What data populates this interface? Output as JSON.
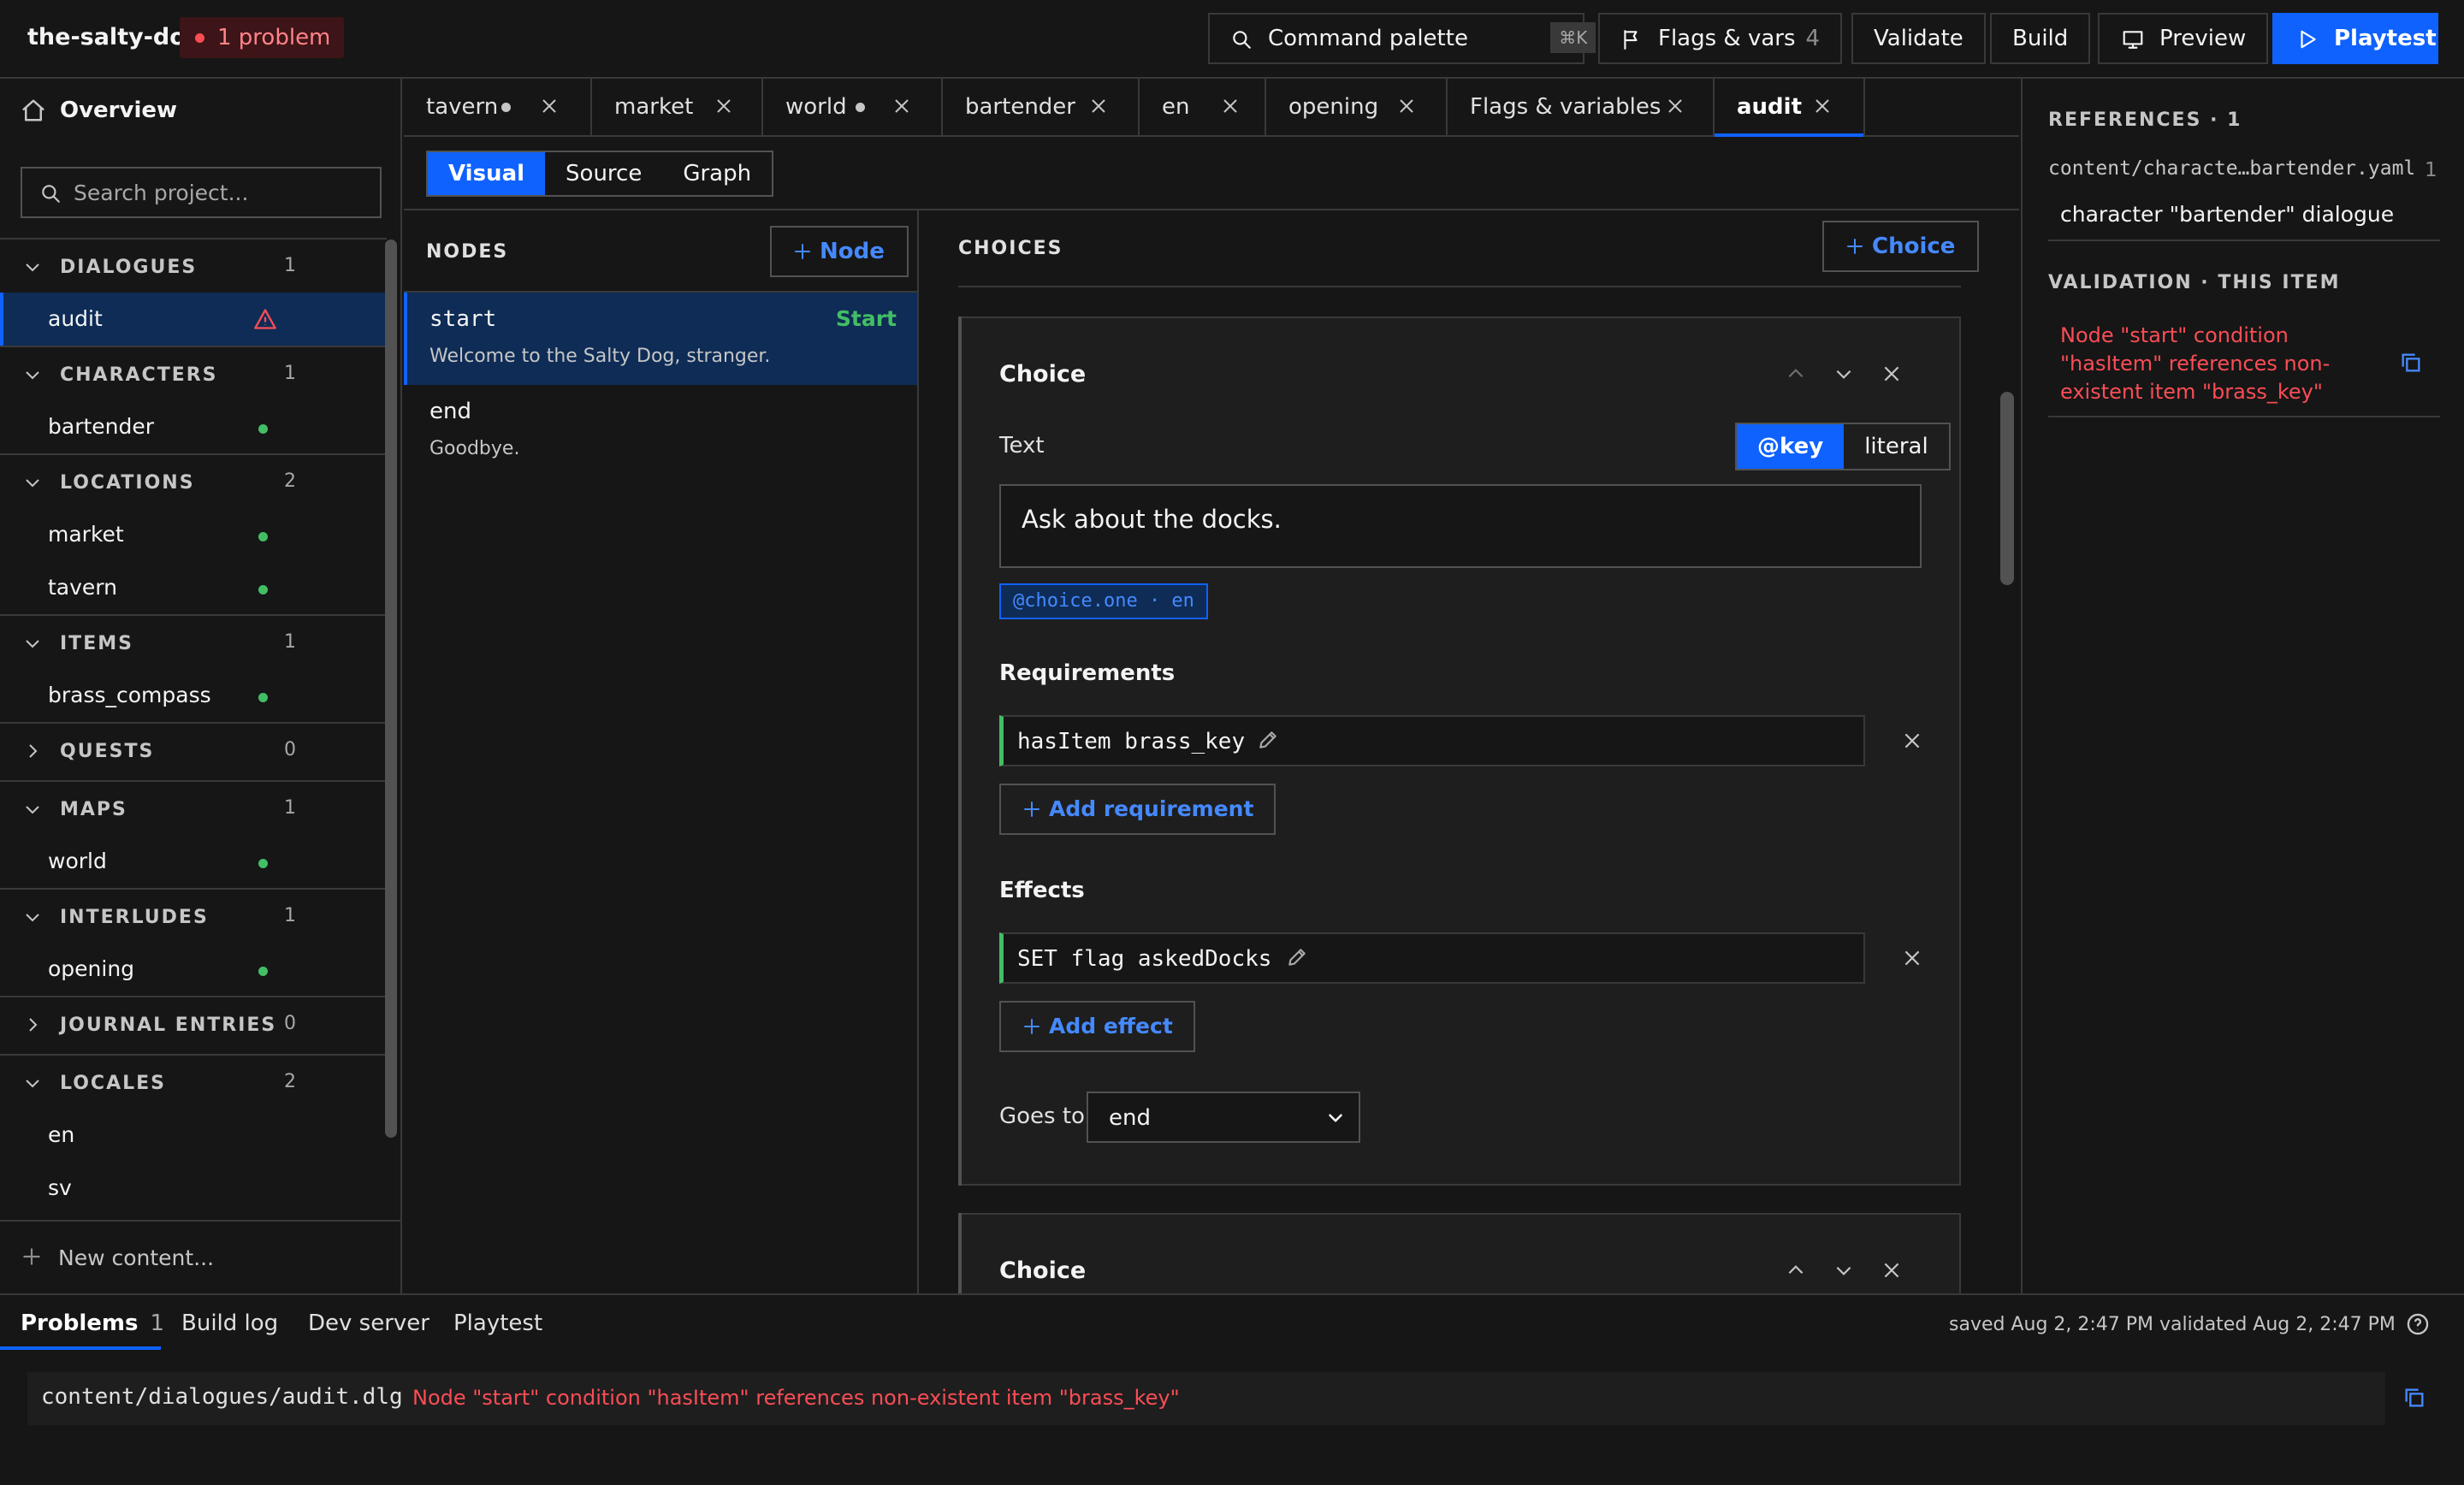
{
  "app": {
    "title": "the-salty-dog",
    "problems_badge": "1 problem"
  },
  "topbar": {
    "command_palette": "Command palette",
    "shortcut": "⌘K",
    "flags_vars": "Flags & vars",
    "flags_count": "4",
    "validate": "Validate",
    "build": "Build",
    "preview": "Preview",
    "playtest": "Playtest"
  },
  "sidebar": {
    "overview": "Overview",
    "search_placeholder": "Search project...",
    "sections": [
      {
        "name": "DIALOGUES",
        "count": "1",
        "items": [
          "audit"
        ]
      },
      {
        "name": "CHARACTERS",
        "count": "1",
        "items": [
          "bartender"
        ]
      },
      {
        "name": "LOCATIONS",
        "count": "2",
        "items": [
          "market",
          "tavern"
        ]
      },
      {
        "name": "ITEMS",
        "count": "1",
        "items": [
          "brass_compass"
        ]
      },
      {
        "name": "QUESTS",
        "count": "0",
        "items": []
      },
      {
        "name": "MAPS",
        "count": "1",
        "items": [
          "world"
        ]
      },
      {
        "name": "INTERLUDES",
        "count": "1",
        "items": [
          "opening"
        ]
      },
      {
        "name": "JOURNAL ENTRIES",
        "count": "0",
        "items": []
      },
      {
        "name": "LOCALES",
        "count": "2",
        "items": [
          "en",
          "sv"
        ]
      }
    ],
    "new_content": "New content..."
  },
  "tabs": [
    "tavern",
    "market",
    "world",
    "bartender",
    "en",
    "opening",
    "Flags & variables",
    "audit"
  ],
  "view_modes": [
    "Visual",
    "Source",
    "Graph"
  ],
  "nodes_panel": {
    "header": "NODES",
    "add_node": "Node",
    "nodes": [
      {
        "name": "start",
        "text": "Welcome to the Salty Dog, stranger.",
        "tag": "Start"
      },
      {
        "name": "end",
        "text": "Goodbye."
      }
    ]
  },
  "choices_panel": {
    "header": "CHOICES",
    "add_choice": "Choice",
    "choice": {
      "title": "Choice",
      "text_label": "Text",
      "mode_key": "@key",
      "mode_literal": "literal",
      "text_value": "Ask about the docks.",
      "key_tag": "@choice.one · en",
      "requirements_label": "Requirements",
      "requirement": "hasItem brass_key",
      "add_requirement": "Add requirement",
      "effects_label": "Effects",
      "effect": "SET flag askedDocks",
      "add_effect": "Add effect",
      "goes_to_label": "Goes to",
      "goes_to_value": "end"
    },
    "choice2_title": "Choice"
  },
  "right_panel": {
    "references_header": "REFERENCES · 1",
    "ref_path": "content/characte…bartender.yaml",
    "ref_line": "1",
    "ref_desc": "character \"bartender\" dialogue",
    "validation_header": "VALIDATION · THIS ITEM",
    "validation_error": "Node \"start\" condition \"hasItem\" references non-existent item \"brass_key\""
  },
  "bottom_panel": {
    "tabs": [
      "Problems",
      "Build log",
      "Dev server",
      "Playtest"
    ],
    "problems_count": "1",
    "saved": "saved Aug 2, 2:47 PM",
    "validated": "validated Aug 2, 2:47 PM",
    "log_path": "content/dialogues/audit.dlg",
    "log_message": "Node \"start\" condition \"hasItem\" references non-existent item \"brass_key\""
  },
  "colors": {
    "accent": "#0f62fe",
    "link": "#4589ff",
    "error": "#fa4d56",
    "success": "#42be65",
    "background": "#161616"
  }
}
